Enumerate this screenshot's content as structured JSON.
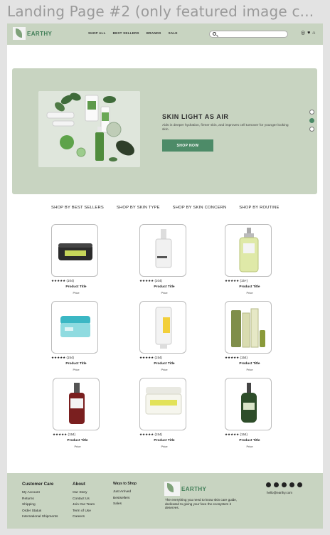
{
  "frame_title": "Landing Page #2 (only featured image c...",
  "nav": {
    "brand": "EARTHY",
    "links": [
      "SHOP ALL",
      "BEST SELLERS",
      "BRANDS",
      "SALE"
    ],
    "search_placeholder": "",
    "icons": [
      "user-icon",
      "heart-icon",
      "cart-icon"
    ]
  },
  "hero": {
    "title": "SKIN LIGHT AS AIR",
    "subtitle": "Aids in deeper hydration, firmer skin, and improves cell turnover for younger looking skin.",
    "cta": "SHOP NOW",
    "slides": 3,
    "active_slide": 2
  },
  "categories": [
    "SHOP BY BEST SELLERS",
    "SHOP BY SKIN TYPE",
    "SHOP BY SKIN CONCERN",
    "SHOP BY ROUTINE"
  ],
  "products": [
    {
      "stars": "★★★★★",
      "reviews": "(104)",
      "title": "Product Title",
      "price": "Price"
    },
    {
      "stars": "★★★★★",
      "reviews": "(104)",
      "title": "Product Title",
      "price": "Price"
    },
    {
      "stars": "★★★★★",
      "reviews": "(15+)",
      "title": "Product Title",
      "price": "Price"
    },
    {
      "stars": "★★★★★",
      "reviews": "(154)",
      "title": "Product Title",
      "price": "Price"
    },
    {
      "stars": "★★★★★",
      "reviews": "(154)",
      "title": "Product Title",
      "price": "Price"
    },
    {
      "stars": "★★★★★",
      "reviews": "(154)",
      "title": "Product Title",
      "price": "Price"
    },
    {
      "stars": "★★★★★",
      "reviews": "(154)",
      "title": "Product Title",
      "price": "Price"
    },
    {
      "stars": "★★★★★",
      "reviews": "(154)",
      "title": "Product Title",
      "price": "Price"
    },
    {
      "stars": "★★★★★",
      "reviews": "(154)",
      "title": "Product Title",
      "price": "Price"
    }
  ],
  "footer": {
    "customer_care": {
      "title": "Customer Care",
      "items": [
        "My Account",
        "Returns",
        "Shipping",
        "Order Status",
        "International Shipments"
      ]
    },
    "about": {
      "title": "About",
      "items": [
        "Our Story",
        "Contact Us",
        "Join Our Team",
        "Term of Use",
        "Careers"
      ]
    },
    "ways": {
      "title": "Ways to Shop",
      "items": [
        "Just Arrived",
        "Bestsellers",
        "Sales"
      ]
    },
    "brand": "EARTHY",
    "tagline": "The everything you need to know skin care guide, dedicated to giving your face the ecosystem it deserves.",
    "social_icons": [
      "facebook-icon",
      "instagram-icon",
      "twitter-icon",
      "youtube-icon",
      "pinterest-icon"
    ],
    "email": "hello@earthy.com"
  },
  "colors": {
    "sage": "#c8d4c1",
    "accent": "#4d8b68"
  }
}
